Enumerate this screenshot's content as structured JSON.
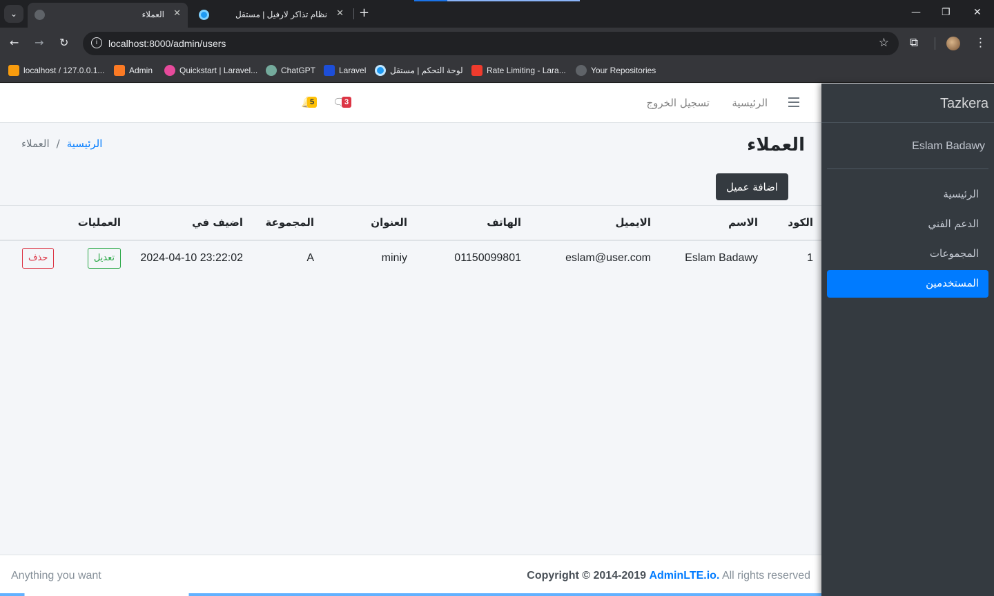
{
  "browser": {
    "tabs": [
      {
        "title": "العملاء",
        "active": true
      },
      {
        "title": "نظام تذاكر لارفيل | مستقل",
        "active": false
      }
    ],
    "url": "localhost:8000/admin/users",
    "bookmarks": [
      {
        "label": "localhost / 127.0.0.1...",
        "icon": "phpmyadmin-icon"
      },
      {
        "label": "Admin",
        "icon": "xampp-icon"
      },
      {
        "label": "Quickstart | Laravel...",
        "icon": "octopus-icon"
      },
      {
        "label": "ChatGPT",
        "icon": "chatgpt-icon"
      },
      {
        "label": "Laravel",
        "icon": "laravel-icon"
      },
      {
        "label": "لوحة التحكم | مستقل",
        "icon": "mostaql-icon"
      },
      {
        "label": "Rate Limiting - Lara...",
        "icon": "laravel-icon"
      },
      {
        "label": "Your Repositories",
        "icon": "github-icon"
      }
    ]
  },
  "sidebar": {
    "brand": "Tazkera",
    "user": "Eslam Badawy",
    "items": [
      {
        "label": "الرئيسية",
        "active": false
      },
      {
        "label": "الدعم الفني",
        "active": false
      },
      {
        "label": "المجموعات",
        "active": false
      },
      {
        "label": "المستخدمين",
        "active": true
      }
    ]
  },
  "navbar": {
    "home": "الرئيسية",
    "logout": "تسجيل الخروج",
    "messages_count": "3",
    "notifications_count": "5"
  },
  "page": {
    "title": "العملاء",
    "breadcrumb_home": "الرئيسية",
    "breadcrumb_current": "العملاء",
    "breadcrumb_sep": "/",
    "add_button": "اضافة عميل"
  },
  "table": {
    "headers": [
      "الكود",
      "الاسم",
      "الايميل",
      "الهاتف",
      "العنوان",
      "المجموعة",
      "اضيف في",
      "العمليات"
    ],
    "rows": [
      {
        "id": "1",
        "name": "Eslam Badawy",
        "email": "eslam@user.com",
        "phone": "01150099801",
        "address": "miniy",
        "group": "A",
        "created": "2024-04-10 23:22:02",
        "edit": "تعديل",
        "delete": "حذف"
      }
    ]
  },
  "footer": {
    "left": "Anything you want",
    "copyright": "Copyright © 2014-2019",
    "link": "AdminLTE.io.",
    "rights": "All rights reserved"
  },
  "colors": {
    "primary": "#007bff",
    "sidebar": "#343a40",
    "success": "#28a745",
    "danger": "#dc3545",
    "warning": "#ffc107"
  }
}
